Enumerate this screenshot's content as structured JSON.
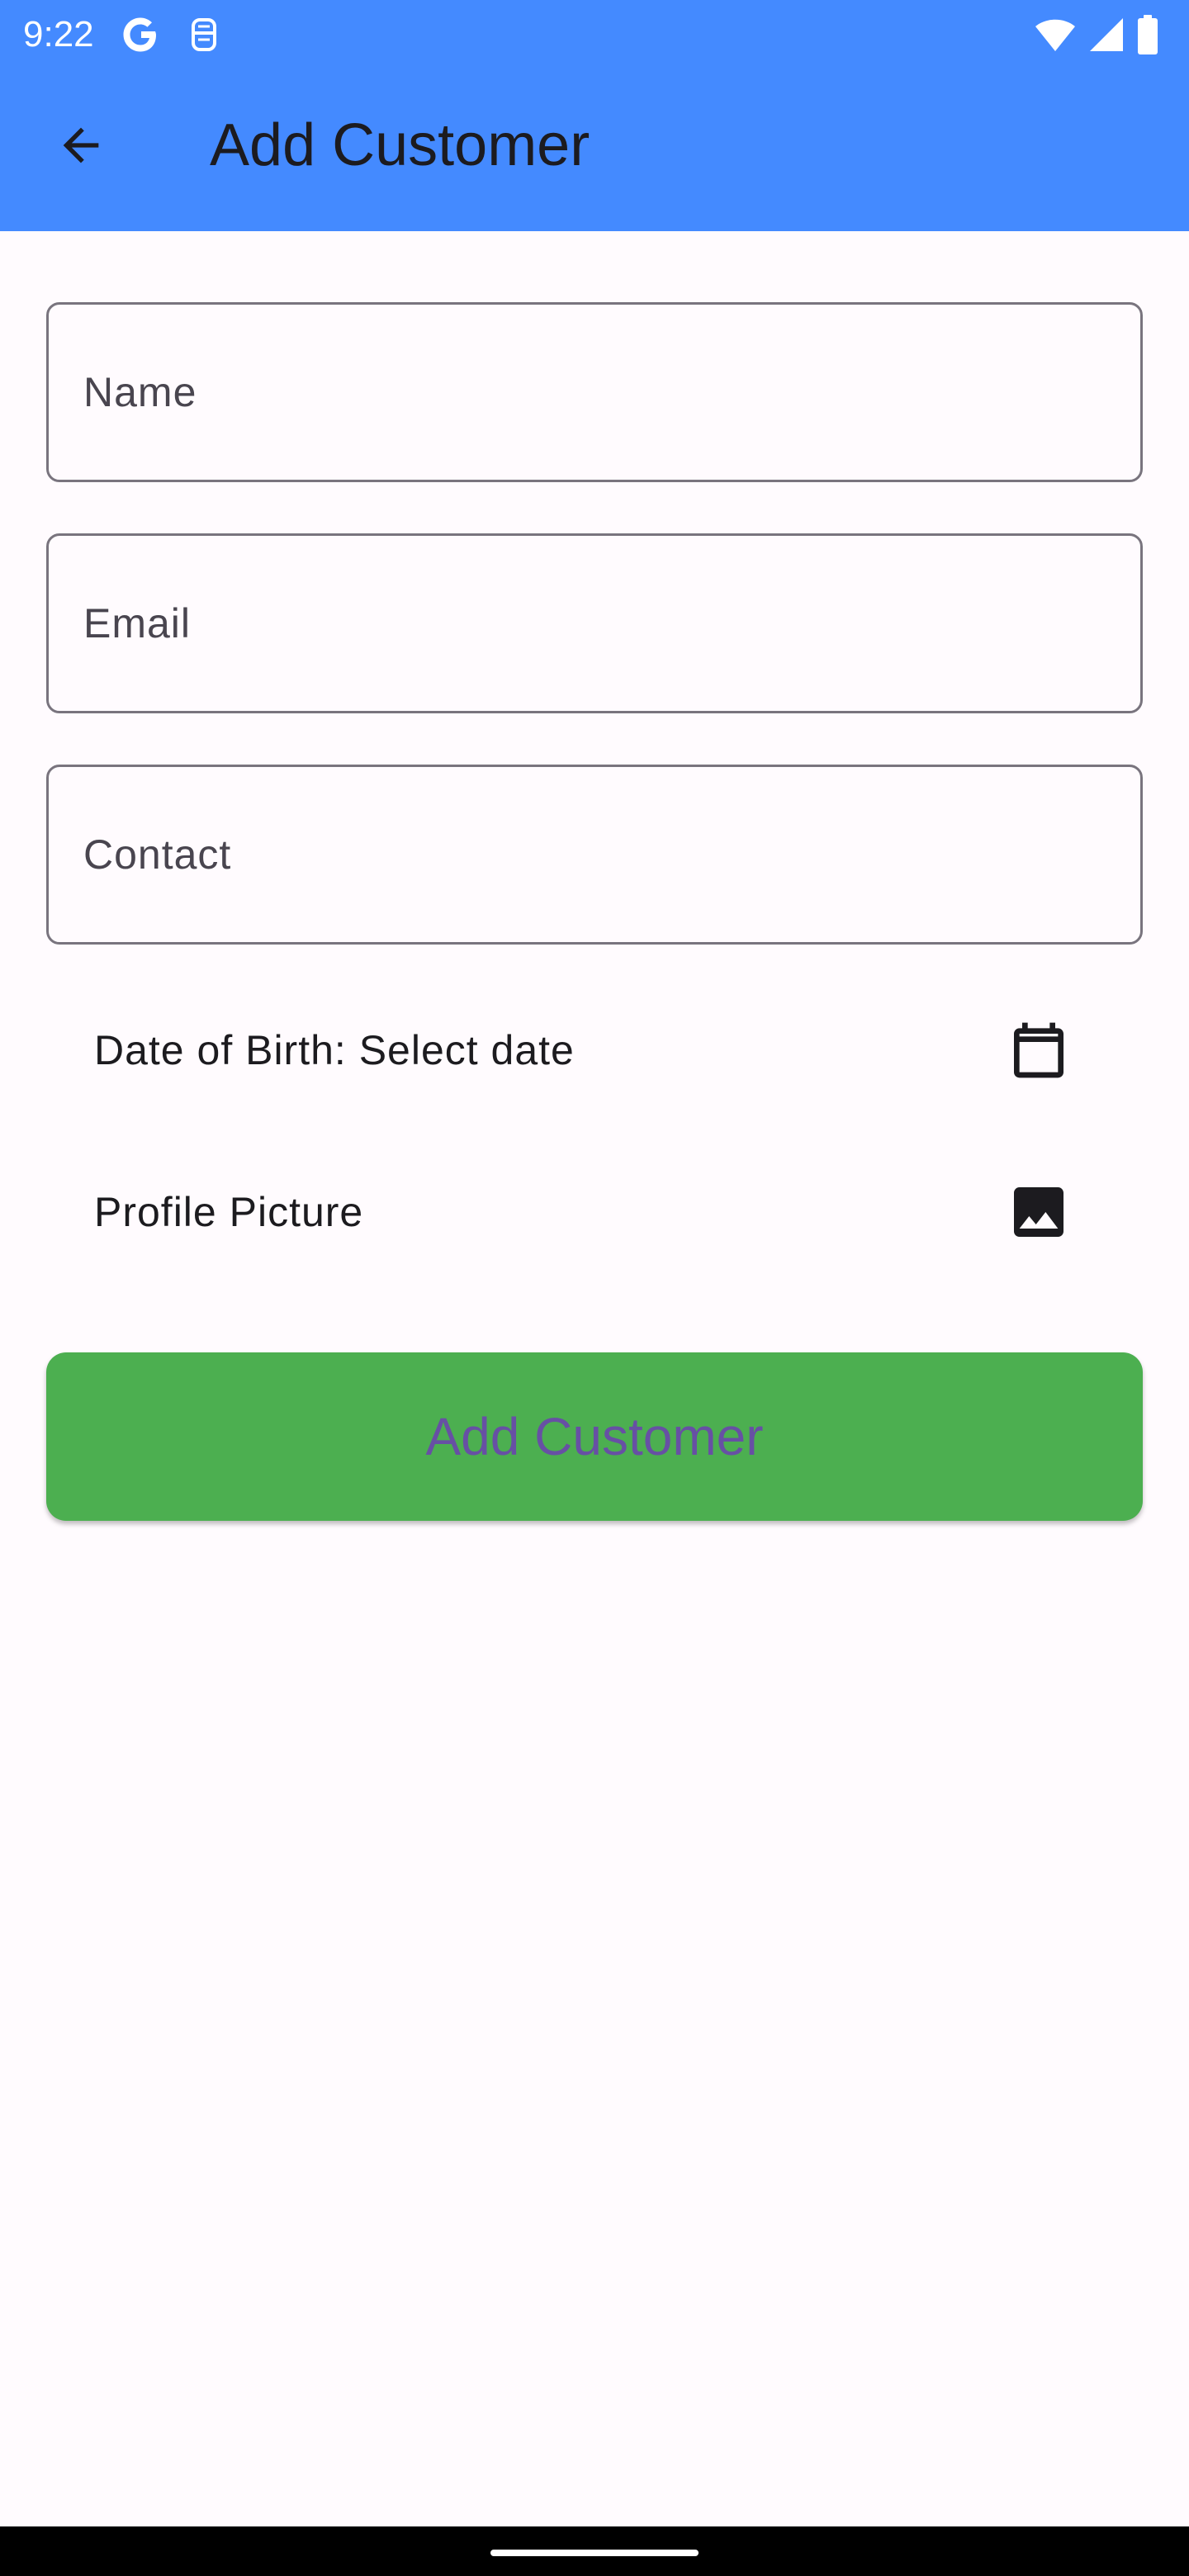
{
  "status_bar": {
    "time": "9:22",
    "icons": [
      "google-g-icon",
      "notification-icon",
      "wifi-icon",
      "cellular-signal-icon",
      "battery-icon"
    ]
  },
  "app_bar": {
    "title": "Add Customer",
    "back_icon": "arrow-back-icon",
    "background": "#448aff"
  },
  "form": {
    "name_placeholder": "Name",
    "email_placeholder": "Email",
    "contact_placeholder": "Contact",
    "dob_label": "Date of Birth: Select date",
    "dob_icon": "calendar-icon",
    "profile_picture_label": "Profile Picture",
    "profile_picture_icon": "image-icon",
    "submit_label": "Add Customer",
    "submit_color": "#4caf50",
    "submit_text_color": "#6750a4"
  }
}
